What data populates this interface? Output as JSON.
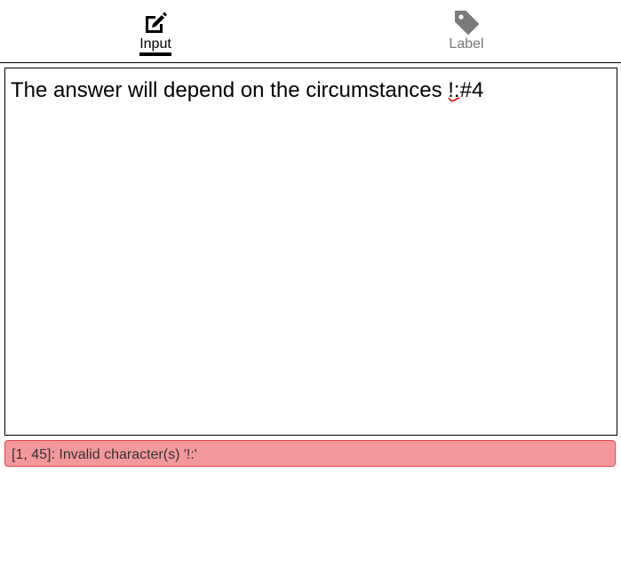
{
  "tabs": {
    "input": {
      "label": "Input",
      "icon": "edit-icon",
      "active": true
    },
    "label": {
      "label": "Label",
      "icon": "tag-icon",
      "active": false
    }
  },
  "editor": {
    "text_before": "The answer will depend on the circumstances ",
    "text_error": "!:",
    "text_after": "#4"
  },
  "error": {
    "message": "[1, 45]: Invalid character(s) '!:'"
  },
  "colors": {
    "active_tab": "#000000",
    "inactive_tab": "#7a7a7a",
    "error_bg": "#f4999b",
    "error_border": "#e04549",
    "squiggle": "#d40000"
  }
}
